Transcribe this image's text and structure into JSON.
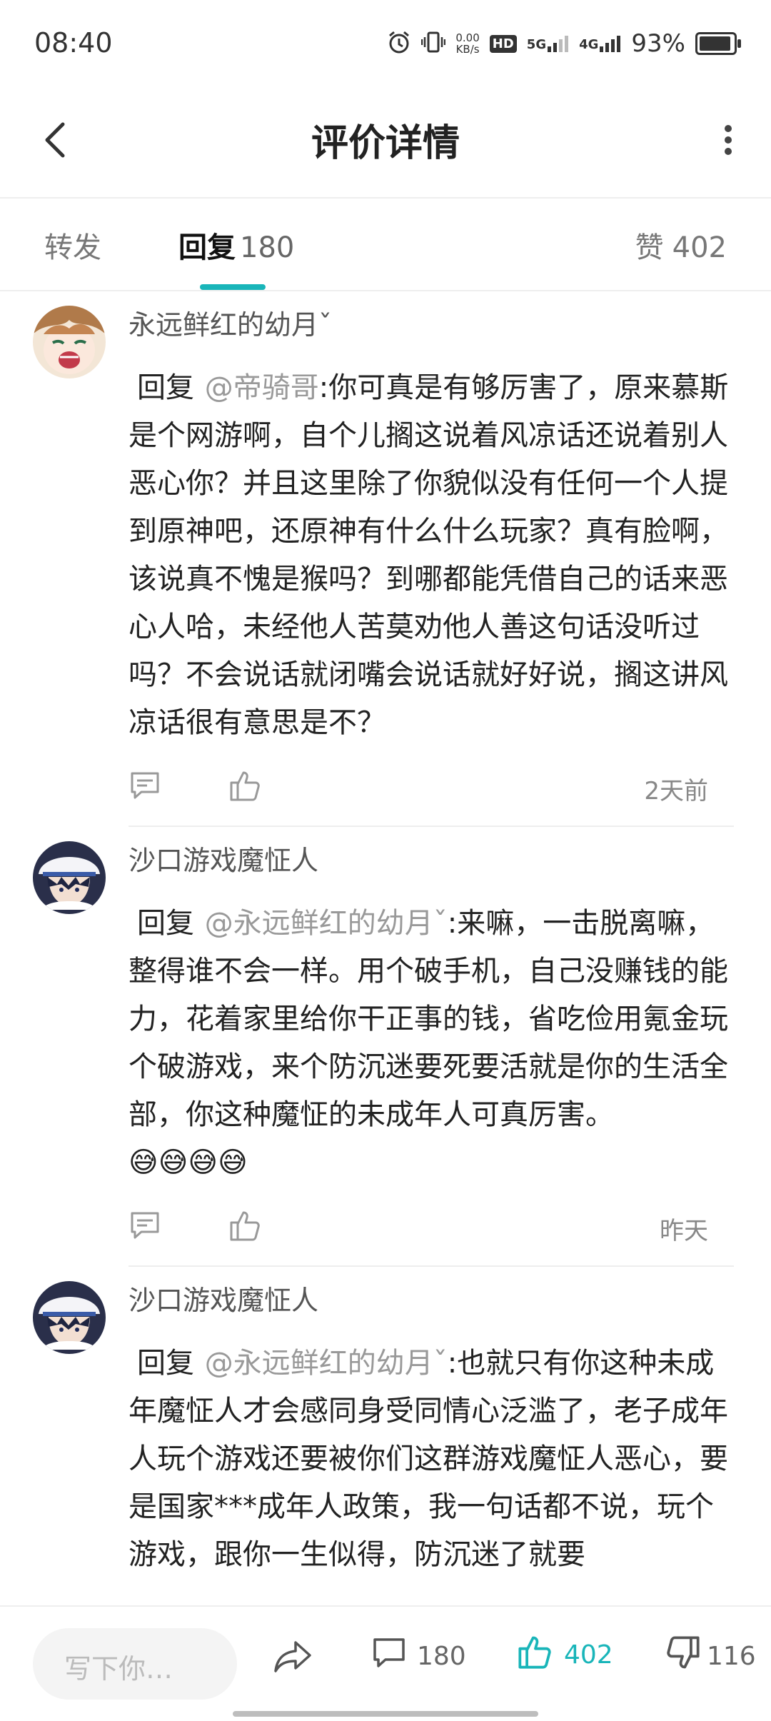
{
  "status_bar": {
    "time": "08:40",
    "net_speed_value": "0.00",
    "net_speed_unit": "KB/s",
    "hd_label": "HD",
    "sim1": "5G",
    "sim2": "4G",
    "battery_percent_text": "93%",
    "battery_level": 0.93
  },
  "header": {
    "title": "评价详情"
  },
  "tabs": {
    "forward": "转发",
    "reply": "回复",
    "reply_count": "180",
    "like": "赞",
    "like_count": "402"
  },
  "comments": [
    {
      "user": "永远鲜红的幼月ˇ",
      "prefix": "回复",
      "mention": "@帝骑哥",
      "text": ":你可真是有够厉害了，原来慕斯是个网游啊，自个儿搁这说着风凉话还说着别人恶心你？并且这里除了你貌似没有任何一个人提到原神吧，还原神有什么什么玩家？真有脸啊，该说真不愧是猴吗？到哪都能凭借自己的话来恶心人哈，未经他人苦莫劝他人善这句话没听过吗？不会说话就闭嘴会说话就好好说，搁这讲风凉话很有意思是不？",
      "emojis": "",
      "time": "2天前"
    },
    {
      "user": "沙口游戏魔怔人",
      "prefix": "回复",
      "mention": "@永远鲜红的幼月ˇ",
      "text": ":来嘛，一击脱离嘛，整得谁不会一样。用个破手机，自己没赚钱的能力，花着家里给你干正事的钱，省吃俭用氪金玩个破游戏，来个防沉迷要死要活就是你的生活全部，你这种魔怔的未成年人可真厉害。",
      "emojis": "😅😅😅😅",
      "time": "昨天"
    },
    {
      "user": "沙口游戏魔怔人",
      "prefix": "回复",
      "mention": "@永远鲜红的幼月ˇ",
      "text": ":也就只有你这种未成年魔怔人才会感同身受同情心泛滥了，老子成年人玩个游戏还要被你们这群游戏魔怔人恶心，要是国家***成年人政策，我一句话都不说，玩个游戏，跟你一生似得，防沉迷了就要",
      "emojis": "",
      "time": ""
    }
  ],
  "bottom_bar": {
    "input_placeholder": "写下你…",
    "comment_count": "180",
    "like_count": "402",
    "dislike_count": "116"
  },
  "colors": {
    "accent": "#19b5b9",
    "mention": "#999999"
  }
}
